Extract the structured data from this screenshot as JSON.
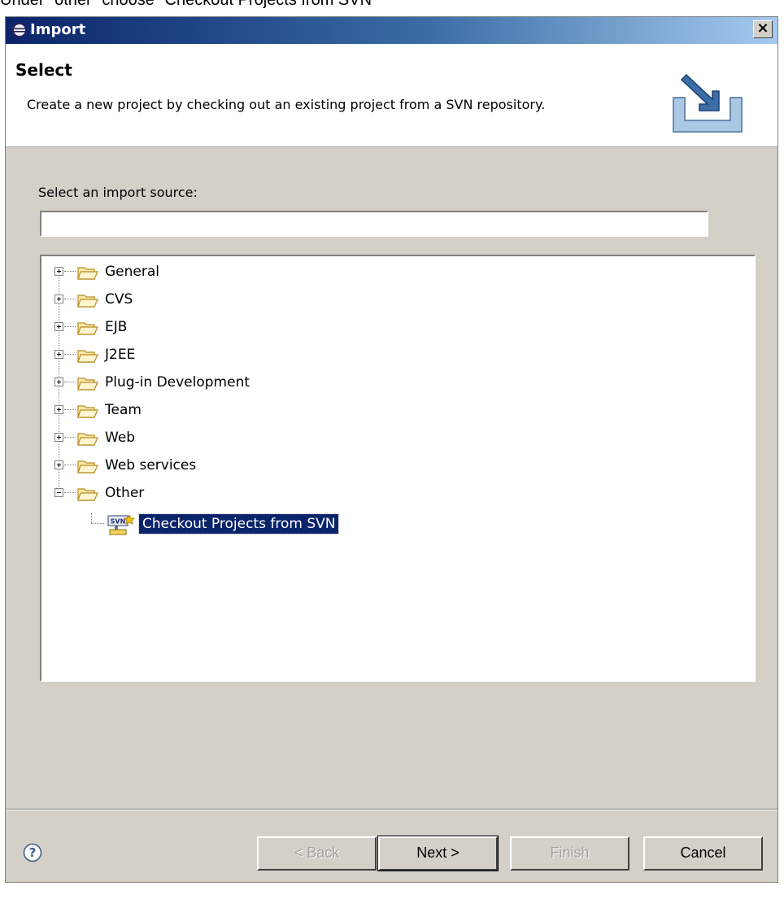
{
  "caption": "Under \"other\" choose \"Checkout Projects from SVN\"",
  "dialog": {
    "title": "Import",
    "close_label": "×"
  },
  "header": {
    "title": "Select",
    "description": "Create a new project by checking out an existing project from a SVN repository."
  },
  "source": {
    "label": "Select an import source:",
    "filter_value": "",
    "filter_placeholder": ""
  },
  "tree": {
    "items": [
      {
        "label": "General",
        "expanded": false
      },
      {
        "label": "CVS",
        "expanded": false
      },
      {
        "label": "EJB",
        "expanded": false
      },
      {
        "label": "J2EE",
        "expanded": false
      },
      {
        "label": "Plug-in Development",
        "expanded": false
      },
      {
        "label": "Team",
        "expanded": false
      },
      {
        "label": "Web",
        "expanded": false
      },
      {
        "label": "Web services",
        "expanded": false
      },
      {
        "label": "Other",
        "expanded": true
      }
    ],
    "child": {
      "label": "Checkout Projects from SVN",
      "selected": true
    }
  },
  "buttons": {
    "back": "< Back",
    "next": "Next >",
    "finish": "Finish",
    "cancel": "Cancel"
  },
  "icons": {
    "title": "eclipse-icon",
    "close": "close-icon",
    "wizard": "import-wizard-icon",
    "folder": "folder-icon",
    "svn": "svn-icon",
    "help": "help-icon"
  },
  "colors": {
    "dialog_bg": "#d4d0c8",
    "titlebar_start": "#0a246a",
    "titlebar_end": "#a6caf0",
    "selection": "#0a246a"
  }
}
